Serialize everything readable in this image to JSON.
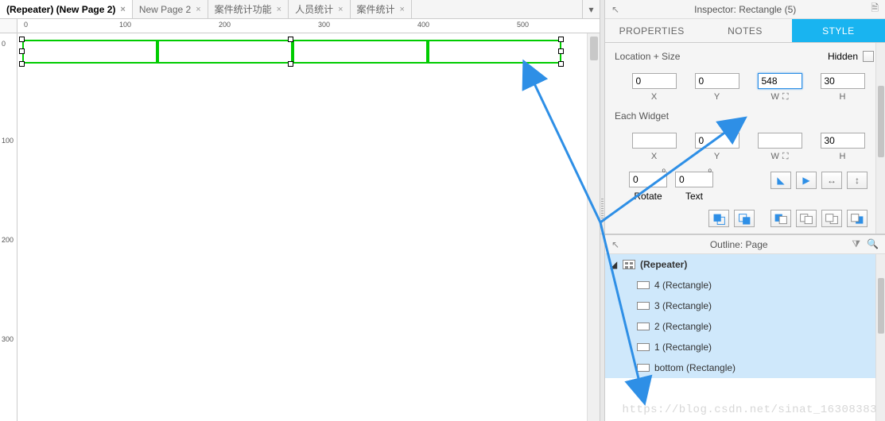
{
  "tabs": [
    {
      "label": "(Repeater) (New Page 2)",
      "active": true,
      "closable": true
    },
    {
      "label": "New Page 2",
      "active": false,
      "closable": true
    },
    {
      "label": "案件统计功能",
      "active": false,
      "closable": true
    },
    {
      "label": "人员统计",
      "active": false,
      "closable": true
    },
    {
      "label": "案件统计",
      "active": false,
      "closable": true
    }
  ],
  "ruler_h": [
    "0",
    "100",
    "200",
    "300",
    "400",
    "500"
  ],
  "ruler_v": [
    "0",
    "100",
    "200",
    "300"
  ],
  "inspector": {
    "title": "Inspector: Rectangle (5)",
    "tabs": {
      "properties": "PROPERTIES",
      "notes": "NOTES",
      "style": "STYLE"
    },
    "section_loc": "Location + Size",
    "hidden_label": "Hidden",
    "labels": {
      "x": "X",
      "y": "Y",
      "w": "W",
      "h": "H",
      "rotate": "Rotate",
      "text": "Text",
      "each": "Each Widget"
    },
    "values": {
      "x": "0",
      "y": "0",
      "w": "548",
      "h": "30",
      "ex": "",
      "ey": "0",
      "ew": "",
      "eh": "30",
      "rot": "0",
      "trot": "0"
    }
  },
  "outline": {
    "title": "Outline: Page",
    "items": [
      {
        "label": "(Repeater)",
        "type": "repeater",
        "bold": true
      },
      {
        "label": "4 (Rectangle)",
        "type": "rect"
      },
      {
        "label": "3 (Rectangle)",
        "type": "rect"
      },
      {
        "label": "2 (Rectangle)",
        "type": "rect"
      },
      {
        "label": "1 (Rectangle)",
        "type": "rect"
      },
      {
        "label": "bottom (Rectangle)",
        "type": "rect"
      }
    ]
  },
  "watermark": "https://blog.csdn.net/sinat_16308383"
}
